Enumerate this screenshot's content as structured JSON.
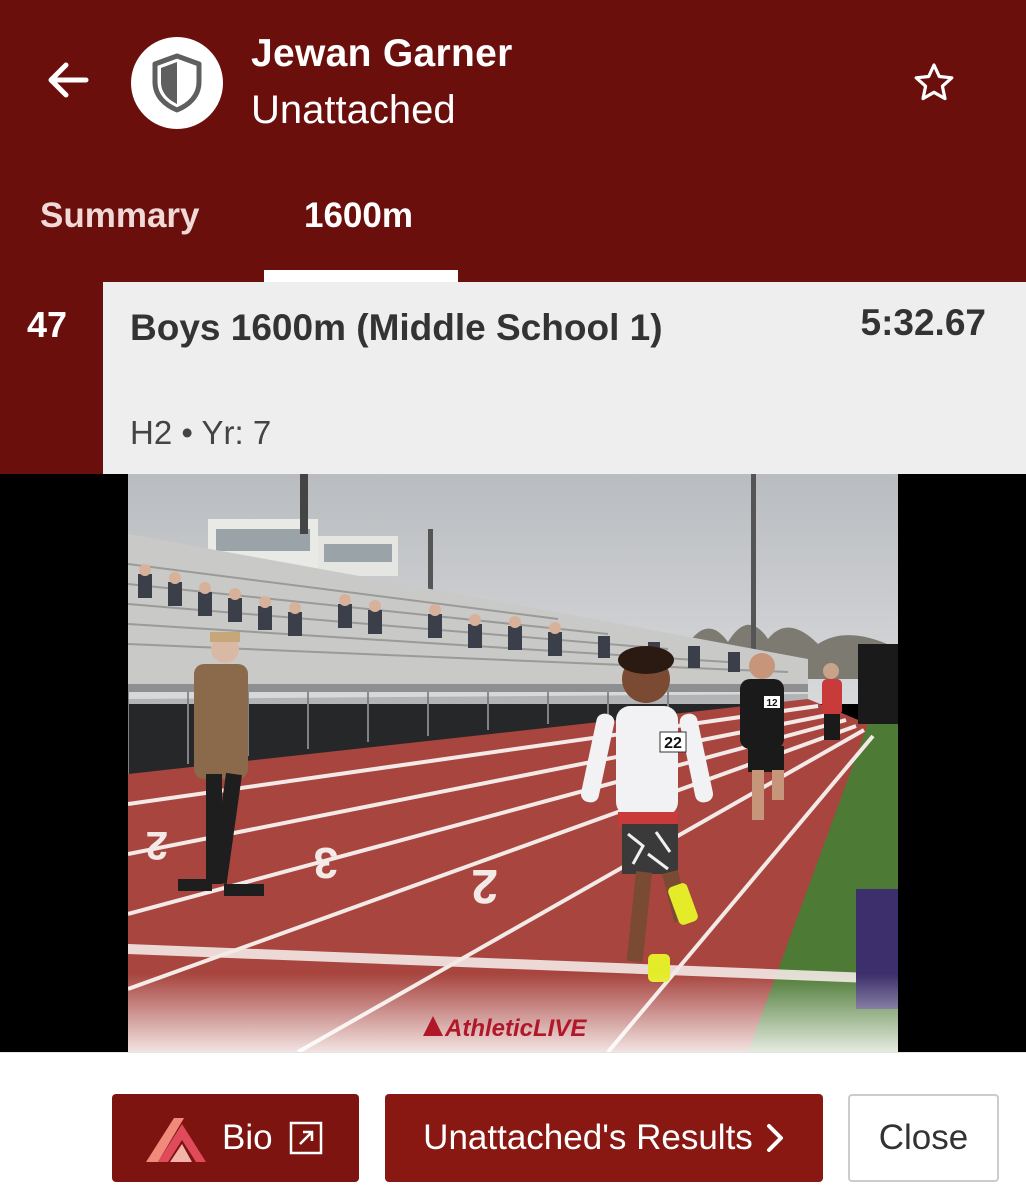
{
  "header": {
    "athlete_name": "Jewan Garner",
    "team": "Unattached",
    "icons": {
      "back": "arrow-left-icon",
      "avatar": "shield-icon",
      "favorite": "star-outline-icon"
    }
  },
  "tabs": [
    {
      "label": "Summary",
      "active": false
    },
    {
      "label": "1600m",
      "active": true
    }
  ],
  "result": {
    "place": "47",
    "event": "Boys 1600m (Middle School 1)",
    "time": "5:32.67",
    "meta": "H2 • Yr: 7"
  },
  "photo": {
    "watermark_brand": "AthleticLIVE",
    "bib_numbers": [
      "22",
      "12",
      "12"
    ],
    "lane_numbers": [
      "2",
      "3",
      "2"
    ]
  },
  "footer": {
    "bio_label": "Bio",
    "results_label": "Unattached's Results",
    "close_label": "Close"
  },
  "colors": {
    "header_bg": "#6a0f0b",
    "button_primary": "#8a1812",
    "result_bg": "#eeeeee"
  }
}
